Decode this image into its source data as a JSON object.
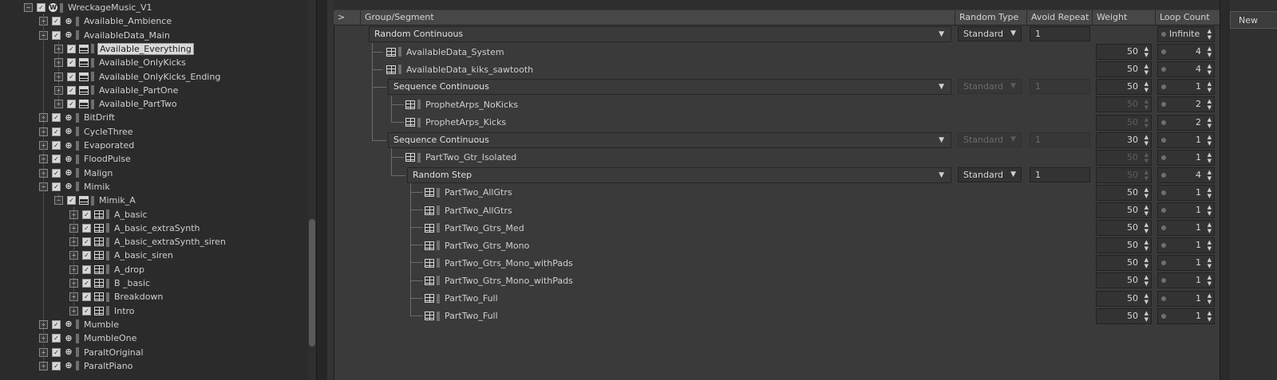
{
  "tree": [
    {
      "label": "WreckageMusic_V1",
      "icon": "wk",
      "exp": "-",
      "depth": 0
    },
    {
      "label": "Available_Ambience",
      "icon": "cont",
      "exp": "+",
      "depth": 1
    },
    {
      "label": "AvailableData_Main",
      "icon": "cont",
      "exp": "-",
      "depth": 1
    },
    {
      "label": "Available_Everything",
      "icon": "seg",
      "exp": "+",
      "depth": 2,
      "selected": true
    },
    {
      "label": "Available_OnlyKicks",
      "icon": "seg",
      "exp": "+",
      "depth": 2
    },
    {
      "label": "Available_OnlyKicks_Ending",
      "icon": "seg",
      "exp": "+",
      "depth": 2
    },
    {
      "label": "Available_PartOne",
      "icon": "seg",
      "exp": "+",
      "depth": 2
    },
    {
      "label": "Available_PartTwo",
      "icon": "seg",
      "exp": "+",
      "depth": 2
    },
    {
      "label": "BitDrift",
      "icon": "cont",
      "exp": "+",
      "depth": 1
    },
    {
      "label": "CycleThree",
      "icon": "cont",
      "exp": "+",
      "depth": 1
    },
    {
      "label": "Evaporated",
      "icon": "cont",
      "exp": "+",
      "depth": 1
    },
    {
      "label": "FloodPulse",
      "icon": "cont",
      "exp": "+",
      "depth": 1
    },
    {
      "label": "Malign",
      "icon": "cont",
      "exp": "+",
      "depth": 1
    },
    {
      "label": "Mimik",
      "icon": "cont",
      "exp": "-",
      "depth": 1
    },
    {
      "label": "Mimik_A",
      "icon": "seg",
      "exp": "-",
      "depth": 2
    },
    {
      "label": "A_basic",
      "icon": "grid",
      "exp": "+",
      "depth": 3
    },
    {
      "label": "A_basic_extraSynth",
      "icon": "grid",
      "exp": "+",
      "depth": 3
    },
    {
      "label": "A_basic_extraSynth_siren",
      "icon": "grid",
      "exp": "+",
      "depth": 3
    },
    {
      "label": "A_basic_siren",
      "icon": "grid",
      "exp": "+",
      "depth": 3
    },
    {
      "label": "A_drop",
      "icon": "grid",
      "exp": "+",
      "depth": 3
    },
    {
      "label": "B _basic",
      "icon": "grid",
      "exp": "+",
      "depth": 3
    },
    {
      "label": "Breakdown",
      "icon": "grid",
      "exp": "+",
      "depth": 3
    },
    {
      "label": "Intro",
      "icon": "grid",
      "exp": "+",
      "depth": 3
    },
    {
      "label": "Mumble",
      "icon": "cont",
      "exp": "+",
      "depth": 1
    },
    {
      "label": "MumbleOne",
      "icon": "cont",
      "exp": "+",
      "depth": 1
    },
    {
      "label": "ParaltOriginal",
      "icon": "cont",
      "exp": "+",
      "depth": 1
    },
    {
      "label": "ParaltPiano",
      "icon": "cont",
      "exp": "+",
      "depth": 1
    }
  ],
  "columns": {
    "expand": ">",
    "group": "Group/Segment",
    "random_type": "Random Type",
    "avoid_repeat": "Avoid Repeat",
    "weight": "Weight",
    "loop_count": "Loop Count"
  },
  "rows": [
    {
      "kind": "group",
      "name": "Random Continuous",
      "depth": 0,
      "random_type": "Standard",
      "rt_enabled": true,
      "avoid": "1",
      "avoid_enabled": true,
      "weight": "",
      "loop": "Infinite"
    },
    {
      "kind": "seg",
      "name": "AvailableData_System",
      "depth": 1,
      "weight": "50",
      "w_enabled": true,
      "loop": "4"
    },
    {
      "kind": "seg",
      "name": "AvailableData_kiks_sawtooth",
      "depth": 1,
      "weight": "50",
      "w_enabled": true,
      "loop": "4"
    },
    {
      "kind": "group",
      "name": "Sequence Continuous",
      "depth": 1,
      "random_type": "Standard",
      "rt_enabled": false,
      "avoid": "1",
      "avoid_enabled": false,
      "weight": "50",
      "w_enabled": true,
      "loop": "1"
    },
    {
      "kind": "seg",
      "name": "ProphetArps_NoKicks",
      "depth": 2,
      "weight": "50",
      "w_enabled": false,
      "loop": "2"
    },
    {
      "kind": "seg",
      "name": "ProphetArps_Kicks",
      "depth": 2,
      "weight": "50",
      "w_enabled": false,
      "loop": "2"
    },
    {
      "kind": "group",
      "name": "Sequence Continuous",
      "depth": 1,
      "random_type": "Standard",
      "rt_enabled": false,
      "avoid": "1",
      "avoid_enabled": false,
      "weight": "30",
      "w_enabled": true,
      "loop": "1"
    },
    {
      "kind": "seg",
      "name": "PartTwo_Gtr_Isolated",
      "depth": 2,
      "weight": "50",
      "w_enabled": false,
      "loop": "1"
    },
    {
      "kind": "group",
      "name": "Random Step",
      "depth": 2,
      "random_type": "Standard",
      "rt_enabled": true,
      "avoid": "1",
      "avoid_enabled": true,
      "weight": "50",
      "w_enabled": false,
      "loop": "4"
    },
    {
      "kind": "seg",
      "name": "PartTwo_AllGtrs",
      "depth": 3,
      "weight": "50",
      "w_enabled": true,
      "loop": "1"
    },
    {
      "kind": "seg",
      "name": "PartTwo_AllGtrs",
      "depth": 3,
      "weight": "50",
      "w_enabled": true,
      "loop": "1"
    },
    {
      "kind": "seg",
      "name": "PartTwo_Gtrs_Med",
      "depth": 3,
      "weight": "50",
      "w_enabled": true,
      "loop": "1"
    },
    {
      "kind": "seg",
      "name": "PartTwo_Gtrs_Mono",
      "depth": 3,
      "weight": "50",
      "w_enabled": true,
      "loop": "1"
    },
    {
      "kind": "seg",
      "name": "PartTwo_Gtrs_Mono_withPads",
      "depth": 3,
      "weight": "50",
      "w_enabled": true,
      "loop": "1"
    },
    {
      "kind": "seg",
      "name": "PartTwo_Gtrs_Mono_withPads",
      "depth": 3,
      "weight": "50",
      "w_enabled": true,
      "loop": "1"
    },
    {
      "kind": "seg",
      "name": "PartTwo_Full",
      "depth": 3,
      "weight": "50",
      "w_enabled": true,
      "loop": "1"
    },
    {
      "kind": "seg",
      "name": "PartTwo_Full",
      "depth": 3,
      "weight": "50",
      "w_enabled": true,
      "loop": "1"
    }
  ],
  "new_button": "New"
}
